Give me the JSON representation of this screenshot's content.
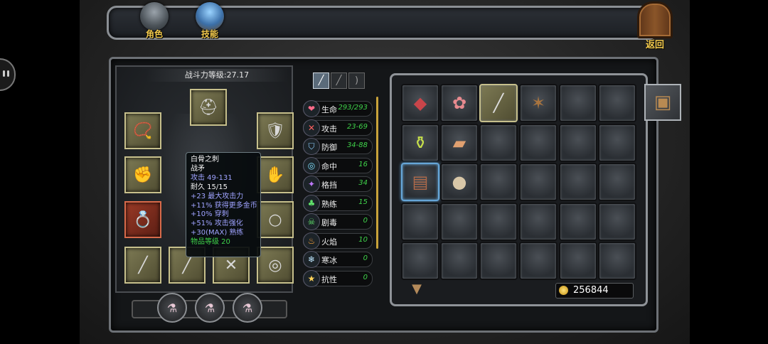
{
  "tabs": [
    {
      "label": "角色",
      "icon": "knight-helmet-icon"
    },
    {
      "label": "技能",
      "icon": "spellbook-icon"
    }
  ],
  "return_label": "返回",
  "power_label": "战斗力等级:27.17",
  "equipment_slots": [
    {
      "slot": "helmet",
      "icon": "helmet-icon"
    },
    {
      "slot": "necklace",
      "icon": "necklace-icon"
    },
    {
      "slot": "armor",
      "icon": "armor-icon"
    },
    {
      "slot": "gloves",
      "icon": "gauntlet-icon"
    },
    {
      "slot": "bracers",
      "icon": "bracer-icon"
    },
    {
      "slot": "ring",
      "icon": "red-ring-icon"
    },
    {
      "slot": "ring2",
      "icon": "silver-ring-icon"
    },
    {
      "slot": "weapon",
      "icon": "mace-icon"
    },
    {
      "slot": "spear",
      "icon": "spear-icon"
    },
    {
      "slot": "crossbow",
      "icon": "crossbow-icon"
    },
    {
      "slot": "shield",
      "icon": "shield-icon"
    }
  ],
  "potions": [
    "potion-icon",
    "potion-icon",
    "potion-icon"
  ],
  "filters": [
    "sword-filter-icon",
    "spear-filter-icon",
    "bow-filter-icon"
  ],
  "stats": [
    {
      "name": "生命",
      "value": "293/293",
      "icon": "heart-icon"
    },
    {
      "name": "攻击",
      "value": "23-69",
      "icon": "crossed-swords-icon"
    },
    {
      "name": "防御",
      "value": "34-88",
      "icon": "shield-icon"
    },
    {
      "name": "命中",
      "value": "16",
      "icon": "target-icon"
    },
    {
      "name": "格挡",
      "value": "34",
      "icon": "dodge-icon"
    },
    {
      "name": "熟练",
      "value": "15",
      "icon": "clover-icon"
    },
    {
      "name": "剧毒",
      "value": "0",
      "icon": "skull-icon"
    },
    {
      "name": "火焰",
      "value": "10",
      "icon": "fire-icon"
    },
    {
      "name": "寒冰",
      "value": "0",
      "icon": "snowflake-icon"
    },
    {
      "name": "抗性",
      "value": "0",
      "icon": "star-icon"
    }
  ],
  "tooltip": {
    "name": "白骨之刺",
    "type": "战矛",
    "attack": "攻击 49-131",
    "durability": "耐久 15/15",
    "mods": [
      "+23 最大攻击力",
      "+11% 获得更多金币",
      "+10% 穿刺",
      "+51% 攻击强化",
      "+30(MAX) 熟练"
    ],
    "level": "物品等级 20"
  },
  "inventory": [
    [
      "meat-icon",
      "raw-meat-icon",
      "spear-icon",
      "hide-icon",
      "",
      ""
    ],
    [
      "potion-bottle-icon",
      "leather-icon",
      "",
      "",
      "",
      ""
    ],
    [
      "scroll-icon",
      "sack-icon",
      "",
      "",
      "",
      ""
    ],
    [
      "",
      "",
      "",
      "",
      "",
      ""
    ],
    [
      "",
      "",
      "",
      "",
      "",
      ""
    ]
  ],
  "gold": "256844",
  "colors": {
    "accent_gold": "#f2c94c",
    "stat_value": "#3fd24a",
    "mod_text": "#9fa3ff"
  }
}
